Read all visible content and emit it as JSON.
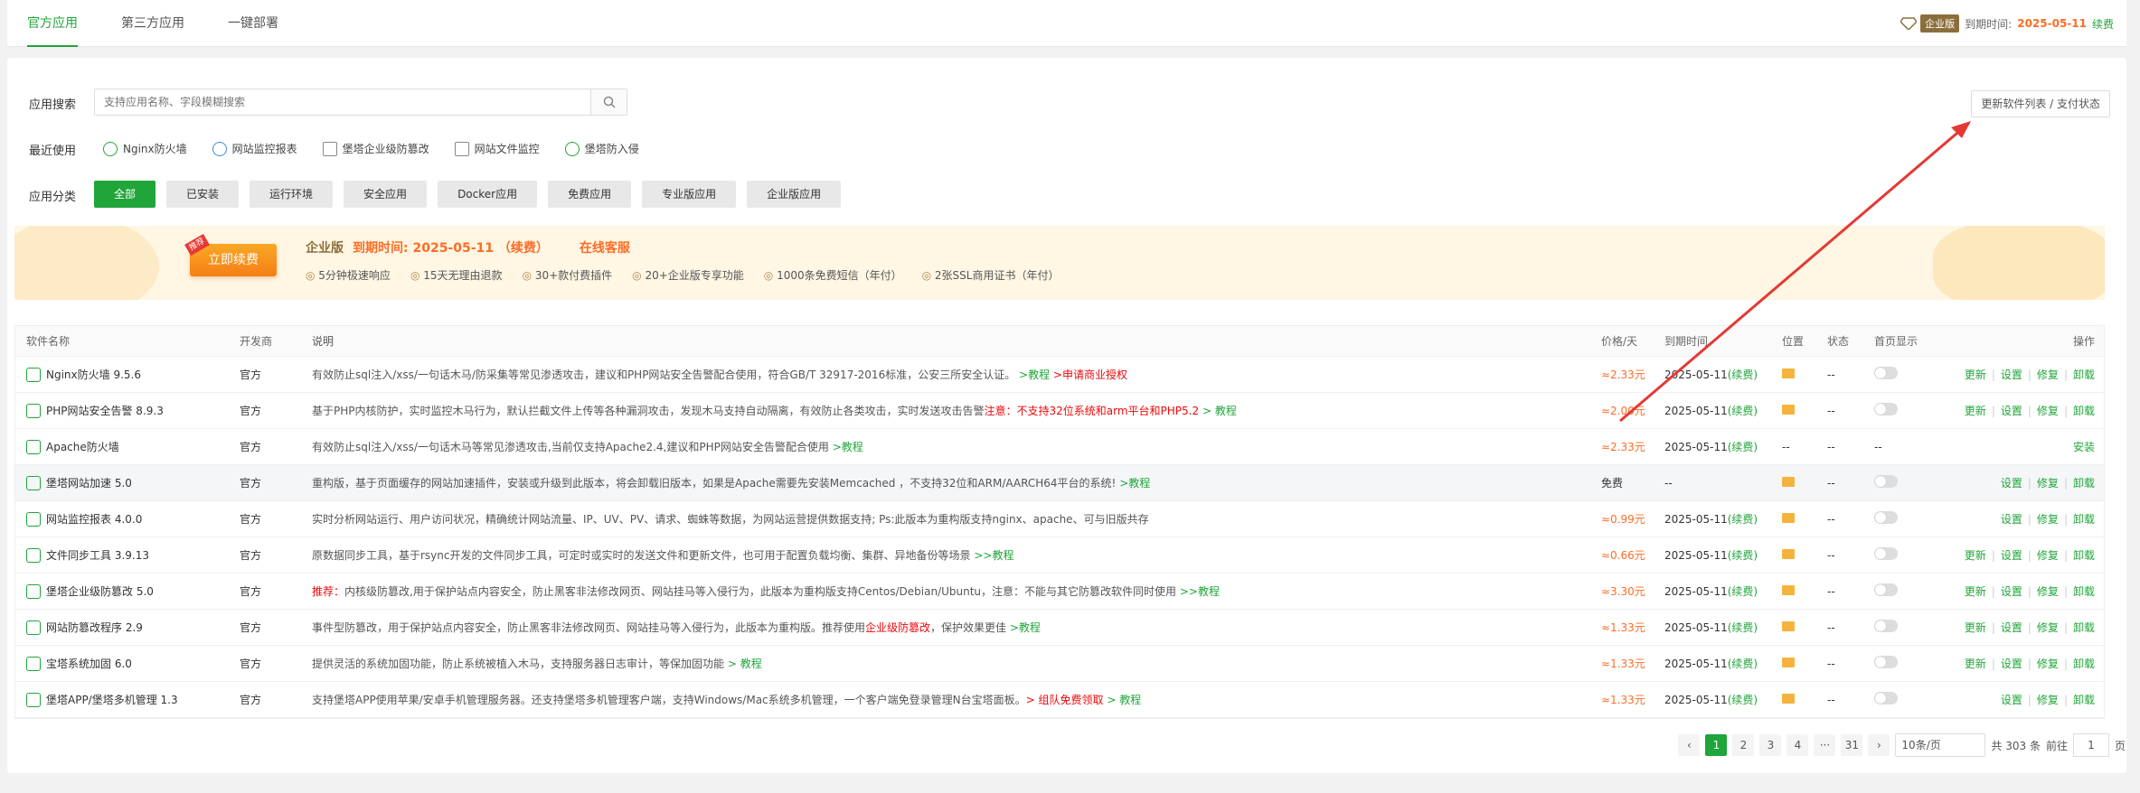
{
  "top_tabs": [
    "官方应用",
    "第三方应用",
    "一键部署"
  ],
  "top_right": {
    "badge": "企业版",
    "expire_label": "到期时间:",
    "expire_date": "2025-05-11",
    "renew": "续费"
  },
  "search": {
    "label": "应用搜索",
    "placeholder": "支持应用名称、字段模糊搜索"
  },
  "update_button": "更新软件列表 / 支付状态",
  "recent": {
    "label": "最近使用",
    "items": [
      "Nginx防火墙",
      "网站监控报表",
      "堡塔企业级防篡改",
      "网站文件监控",
      "堡塔防入侵"
    ]
  },
  "categories": {
    "label": "应用分类",
    "items": [
      "全部",
      "已安装",
      "运行环境",
      "安全应用",
      "Docker应用",
      "免费应用",
      "专业版应用",
      "企业版应用"
    ]
  },
  "banner": {
    "renew_button": "立即续费",
    "renew_tag": "推荐",
    "edition": "企业版",
    "expire": "到期时间: 2025-05-11 （续费）",
    "service": "在线客服",
    "features": [
      "5分钟极速响应",
      "15天无理由退款",
      "30+款付费插件",
      "20+企业版专享功能",
      "1000条免费短信（年付）",
      "2张SSL商用证书（年付）"
    ]
  },
  "table": {
    "headers": [
      "软件名称",
      "开发商",
      "说明",
      "价格/天",
      "到期时间",
      "位置",
      "状态",
      "首页显示",
      "操作"
    ],
    "rows": [
      {
        "name": "Nginx防火墙 9.5.6",
        "dev": "官方",
        "desc": "有效防止sql注入/xss/一句话木马/防采集等常见渗透攻击，建议和PHP网站安全告警配合使用，符合GB/T 32917-2016标准，公安三所安全认证。",
        "desc_green": ">教程",
        "desc_red": ">申请商业授权",
        "price": "≈2.33元",
        "exp": "2025-05-11",
        "exp_tag": "(续费)",
        "pos": true,
        "status": "--",
        "home": true,
        "ops": [
          "更新",
          "设置",
          "修复",
          "卸载"
        ]
      },
      {
        "name": "PHP网站安全告警 8.9.3",
        "dev": "官方",
        "desc": "基于PHP内核防护，实时监控木马行为，默认拦截文件上传等各种漏洞攻击，发现木马支持自动隔离，有效防止各类攻击，实时发送攻击告警",
        "desc_red": "注意：不支持32位系统和arm平台和PHP5.2",
        "desc_green": "> 教程",
        "price": "≈2.00元",
        "exp": "2025-05-11",
        "exp_tag": "(续费)",
        "pos": true,
        "status": "--",
        "home": true,
        "ops": [
          "更新",
          "设置",
          "修复",
          "卸载"
        ]
      },
      {
        "name": "Apache防火墙",
        "dev": "官方",
        "desc": "有效防止sql注入/xss/一句话木马等常见渗透攻击,当前仅支持Apache2.4,建议和PHP网站安全告警配合使用",
        "desc_green": ">教程",
        "price": "≈2.33元",
        "exp": "2025-05-11",
        "exp_tag": "(续费)",
        "pos_text": "--",
        "status": "--",
        "home_text": "--",
        "ops": [
          "安装"
        ]
      },
      {
        "name": "堡塔网站加速 5.0",
        "dev": "官方",
        "desc": "重构版，基于页面缓存的网站加速插件，安装或升级到此版本，将会卸载旧版本，如果是Apache需要先安装Memcached ，不支持32位和ARM/AARCH64平台的系统!",
        "desc_green": ">教程",
        "price_free": "免费",
        "exp_text": "--",
        "pos": true,
        "status": "--",
        "home": true,
        "ops": [
          "设置",
          "修复",
          "卸载"
        ],
        "hl": true
      },
      {
        "name": "网站监控报表 4.0.0",
        "dev": "官方",
        "desc": "实时分析网站运行、用户访问状况，精确统计网站流量、IP、UV、PV、请求、蜘蛛等数据，为网站运营提供数据支持; Ps:此版本为重构版支持nginx、apache、可与旧版共存",
        "price": "≈0.99元",
        "exp": "2025-05-11",
        "exp_tag": "(续费)",
        "pos": true,
        "status": "--",
        "home": true,
        "ops": [
          "设置",
          "修复",
          "卸载"
        ]
      },
      {
        "name": "文件同步工具 3.9.13",
        "dev": "官方",
        "desc": "原数据同步工具，基于rsync开发的文件同步工具，可定时或实时的发送文件和更新文件，也可用于配置负载均衡、集群、异地备份等场景",
        "desc_green": ">>教程",
        "price": "≈0.66元",
        "exp": "2025-05-11",
        "exp_tag": "(续费)",
        "pos": true,
        "status": "--",
        "home": true,
        "ops": [
          "更新",
          "设置",
          "修复",
          "卸载"
        ]
      },
      {
        "name": "堡塔企业级防篡改 5.0",
        "dev": "官方",
        "desc_red_prefix": "推荐：",
        "desc": "内核级防篡改,用于保护站点内容安全，防止黑客非法修改网页、网站挂马等入侵行为，此版本为重构版支持Centos/Debian/Ubuntu，注意：不能与其它防篡改软件同时使用",
        "desc_green": ">>教程",
        "price": "≈3.30元",
        "exp": "2025-05-11",
        "exp_tag": "(续费)",
        "pos": true,
        "status": "--",
        "home": true,
        "ops": [
          "更新",
          "设置",
          "修复",
          "卸载"
        ]
      },
      {
        "name": "网站防篡改程序 2.9",
        "dev": "官方",
        "desc": "事件型防篡改，用于保护站点内容安全，防止黑客非法修改网页、网站挂马等入侵行为，此版本为重构版。推荐使用",
        "desc_red": "企业级防篡改",
        "desc_tail": "，保护效果更佳",
        "desc_green": ">教程",
        "price": "≈1.33元",
        "exp": "2025-05-11",
        "exp_tag": "(续费)",
        "pos": true,
        "status": "--",
        "home": true,
        "ops": [
          "更新",
          "设置",
          "修复",
          "卸载"
        ]
      },
      {
        "name": "宝塔系统加固 6.0",
        "dev": "官方",
        "desc": "提供灵活的系统加固功能，防止系统被植入木马，支持服务器日志审计，等保加固功能",
        "desc_green": "> 教程",
        "price": "≈1.33元",
        "exp": "2025-05-11",
        "exp_tag": "(续费)",
        "pos": true,
        "status": "--",
        "home": true,
        "ops": [
          "更新",
          "设置",
          "修复",
          "卸载"
        ]
      },
      {
        "name": "堡塔APP/堡塔多机管理 1.3",
        "dev": "官方",
        "desc": "支持堡塔APP使用苹果/安卓手机管理服务器。还支持堡塔多机管理客户端，支持Windows/Mac系统多机管理，一个客户端免登录管理N台宝塔面板。",
        "desc_red": "> 组队免费领取",
        "desc_green": "> 教程",
        "price": "≈1.33元",
        "exp": "2025-05-11",
        "exp_tag": "(续费)",
        "pos": true,
        "status": "--",
        "home": true,
        "ops": [
          "设置",
          "修复",
          "卸载"
        ]
      }
    ]
  },
  "pagination": {
    "pages": [
      "1",
      "2",
      "3",
      "4",
      "···",
      "31"
    ],
    "per_page": "10条/页",
    "total": "共 303 条",
    "goto": "前往",
    "goto_value": "1",
    "page_unit": "页"
  }
}
